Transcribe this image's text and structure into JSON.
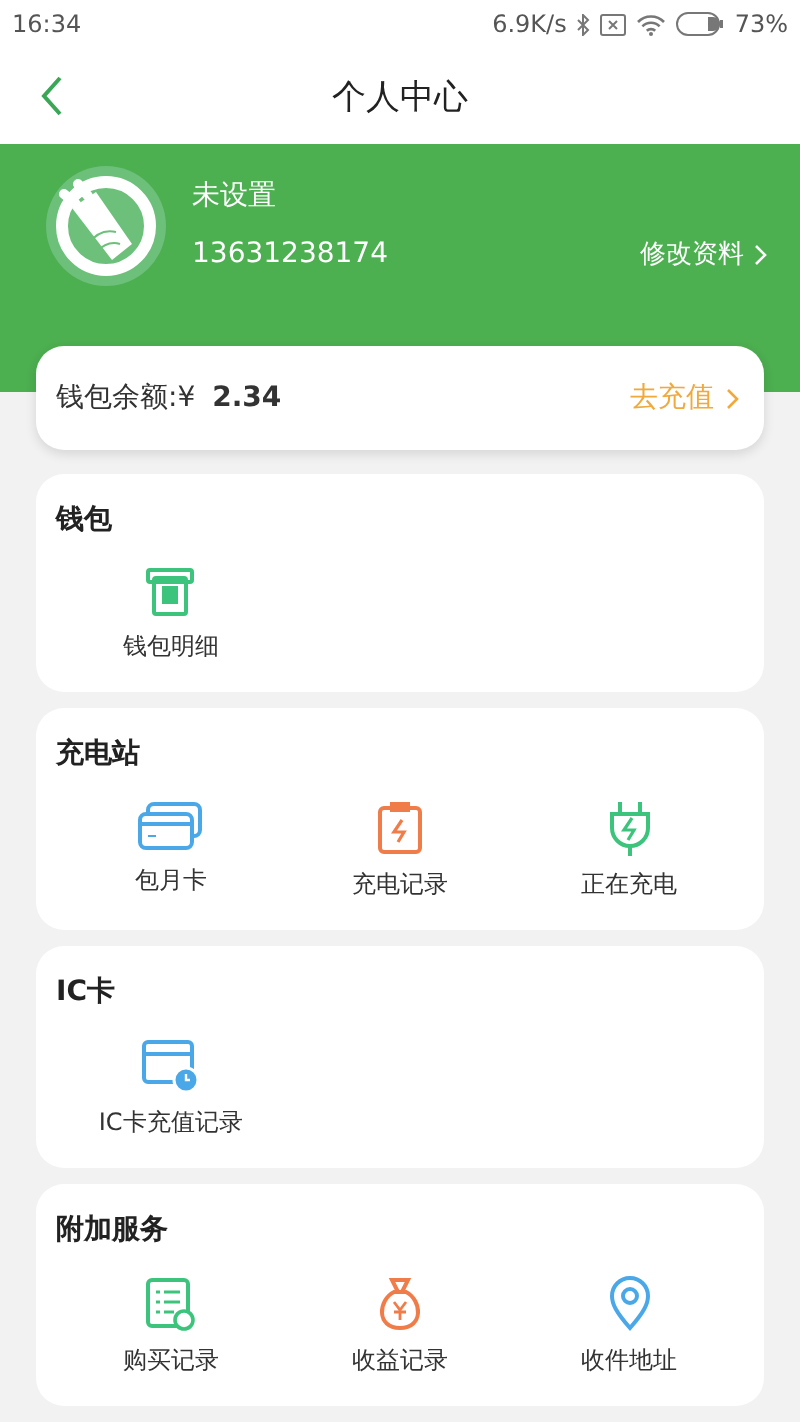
{
  "status_bar": {
    "time": "16:34",
    "net_speed": "6.9K/s",
    "battery": "73%"
  },
  "nav": {
    "title": "个人中心"
  },
  "profile": {
    "name": "未设置",
    "phone": "13631238174",
    "edit_link": "修改资料"
  },
  "wallet": {
    "balance": "钱包余额:¥ **2.34**",
    "action": "去充值"
  },
  "sections": [
    {
      "title": "钱包",
      "items": [
        {
          "label": "钱包明细"
        }
      ]
    },
    {
      "title": "充电站",
      "items": [
        {
          "label": "包月卡"
        },
        {
          "label": "充电记录"
        },
        {
          "label": "正在充电"
        }
      ]
    },
    {
      "title": "IC卡",
      "items": [
        {
          "label": "IC卡充值记录"
        }
      ]
    },
    {
      "title": "附加服务",
      "items": [
        {
          "label": "购买记录"
        },
        {
          "label": "收益记录"
        },
        {
          "label": "收件地址"
        }
      ]
    }
  ]
}
